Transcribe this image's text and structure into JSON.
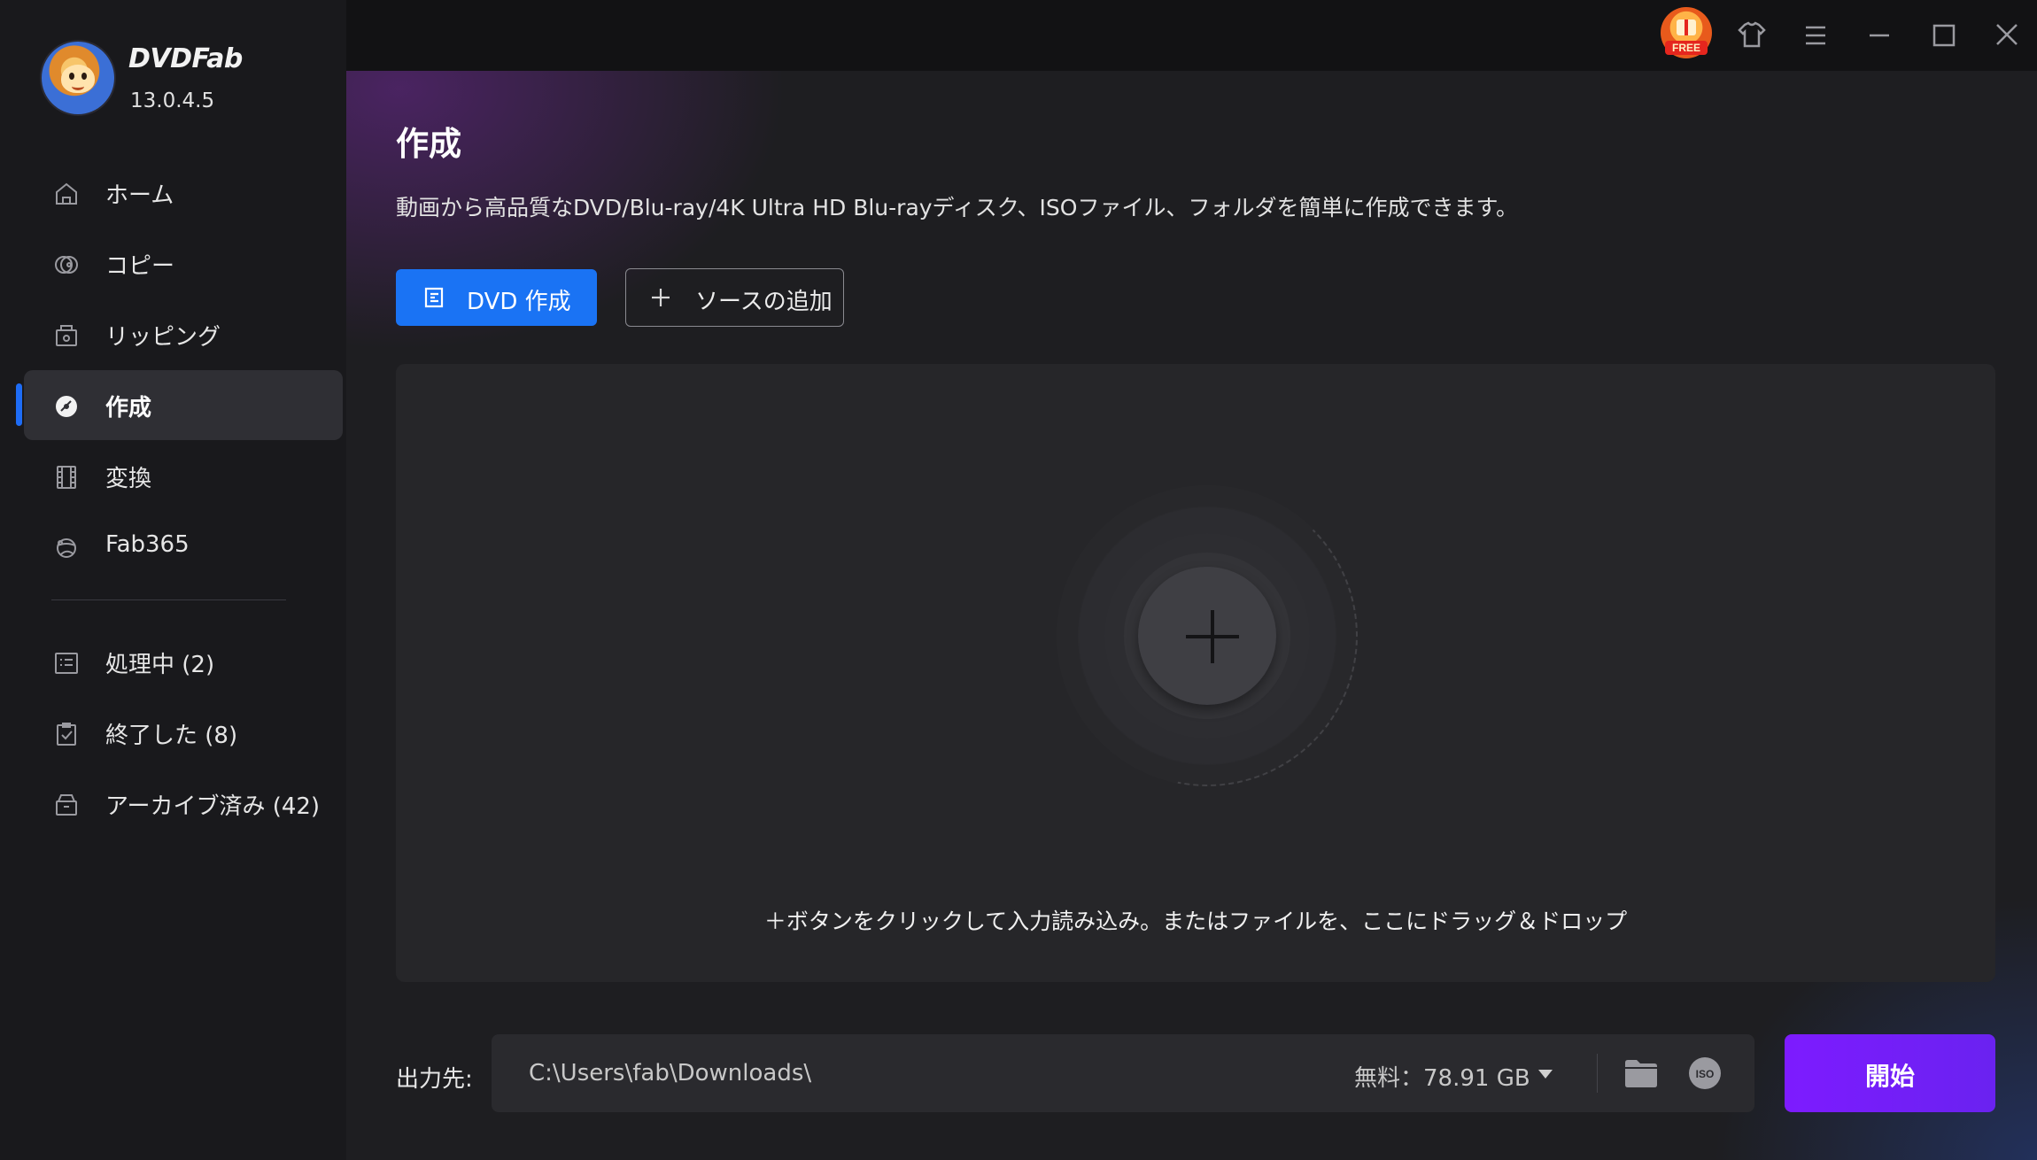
{
  "app": {
    "name": "DVDFab",
    "version": "13.0.4.5"
  },
  "titlebar": {
    "free_badge": "FREE",
    "icons": [
      "free-gift-icon",
      "tshirt-skin-icon",
      "menu-icon",
      "minimize-icon",
      "maximize-icon",
      "close-icon"
    ]
  },
  "sidebar": {
    "items": [
      {
        "label": "ホーム",
        "icon": "home-icon"
      },
      {
        "label": "コピー",
        "icon": "copy-disc-icon"
      },
      {
        "label": "リッピング",
        "icon": "ripping-icon"
      },
      {
        "label": "作成",
        "icon": "creator-disc-icon",
        "active": true
      },
      {
        "label": "変換",
        "icon": "film-icon"
      },
      {
        "label": "Fab365",
        "icon": "fab365-icon"
      }
    ],
    "tasks": [
      {
        "label": "処理中 (2)",
        "icon": "processing-list-icon"
      },
      {
        "label": "終了した (8)",
        "icon": "finished-clipboard-icon"
      },
      {
        "label": "アーカイブ済み (42)",
        "icon": "archive-box-icon"
      }
    ]
  },
  "main": {
    "title": "作成",
    "description": "動画から高品質なDVD/Blu-ray/4K Ultra HD Blu-rayディスク、ISOファイル、フォルダを簡単に作成できます。",
    "mode_button": "DVD 作成",
    "add_source_button": "ソースの追加",
    "drop_hint": "＋ボタンをクリックして入力読み込み。またはファイルを、ここにドラッグ＆ドロップ"
  },
  "output": {
    "label": "出力先:",
    "path": "C:\\Users\\fab\\Downloads\\",
    "free_space": "無料：78.91 GB",
    "start_button": "開始"
  },
  "colors": {
    "accent_blue": "#1a73f4",
    "start_purple": "#7d1bff",
    "sidebar_bg": "#19191c",
    "main_bg": "#1e1e21"
  }
}
